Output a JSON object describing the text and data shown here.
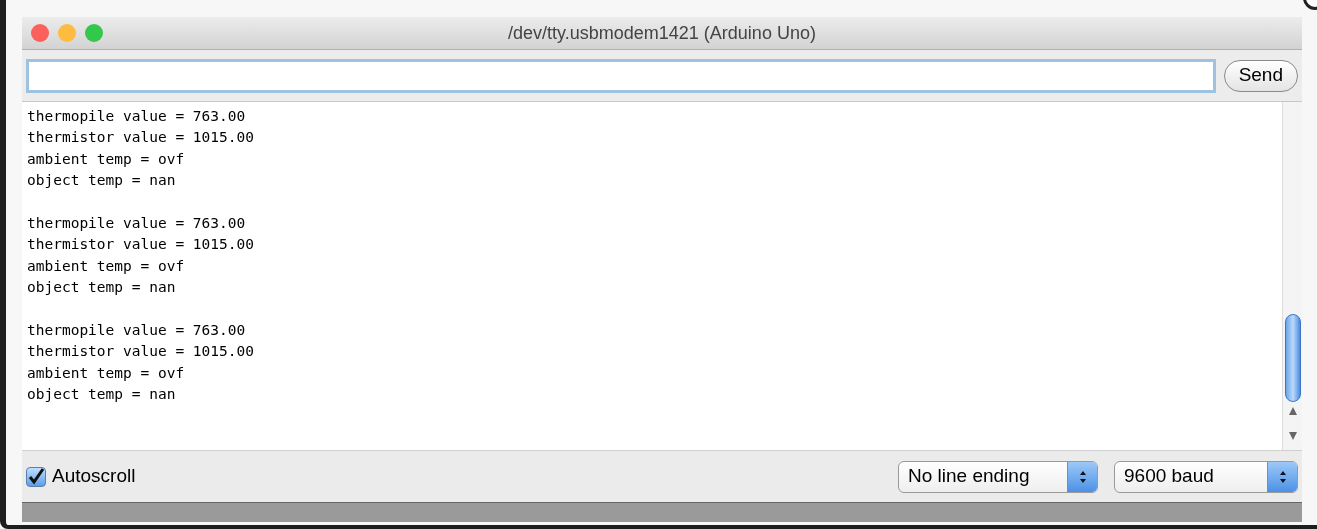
{
  "window": {
    "title": "/dev/tty.usbmodem1421 (Arduino Uno)"
  },
  "send_button": {
    "label": "Send"
  },
  "output": {
    "blocks": [
      [
        "thermopile value = 763.00",
        "thermistor value = 1015.00",
        "ambient temp = ovf",
        "object temp = nan"
      ],
      [
        "thermopile value = 763.00",
        "thermistor value = 1015.00",
        "ambient temp = ovf",
        "object temp = nan"
      ],
      [
        "thermopile value = 763.00",
        "thermistor value = 1015.00",
        "ambient temp = ovf",
        "object temp = nan"
      ]
    ]
  },
  "autoscroll": {
    "label": "Autoscroll",
    "checked": true
  },
  "line_ending": {
    "value": "No line ending"
  },
  "baud": {
    "value": "9600 baud"
  }
}
